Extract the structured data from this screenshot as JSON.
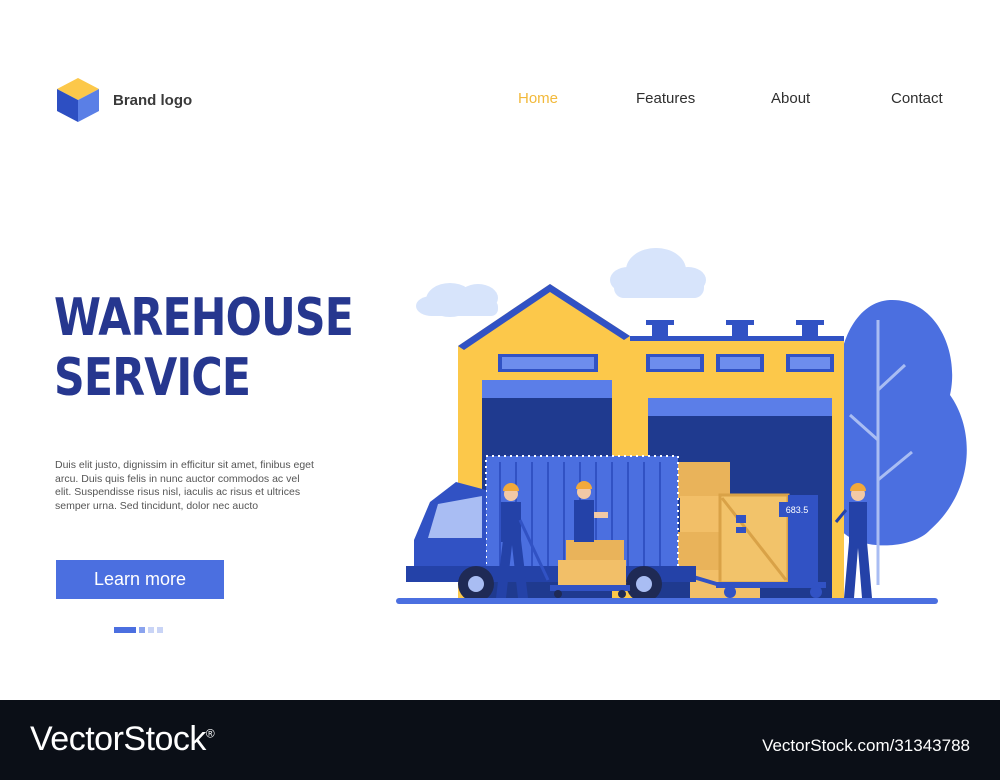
{
  "brand": {
    "label": "Brand logo",
    "icon": "cube-icon"
  },
  "nav": {
    "items": [
      {
        "label": "Home",
        "active": true
      },
      {
        "label": "Features",
        "active": false
      },
      {
        "label": "About",
        "active": false
      },
      {
        "label": "Contact",
        "active": false
      }
    ]
  },
  "hero": {
    "title_line1": "WAREHOUSE",
    "title_line2": "SERVICE",
    "body": "Duis elit justo, dignissim in efficitur sit amet, finibus eget arcu. Duis quis felis in nunc auctor commodos ac vel elit. Suspendisse risus nisl, iaculis ac risus et ultrices semper urna. Sed tincidunt, dolor nec aucto",
    "cta_label": "Learn more"
  },
  "carousel": {
    "slides": 4,
    "active_index": 0
  },
  "illustration": {
    "scale_reading": "683.5"
  },
  "watermark": {
    "left": "VectorStock",
    "reg": "®",
    "right": "VectorStock.com/31343788"
  },
  "colors": {
    "accent_blue": "#4b6fe0",
    "title_navy": "#26378f",
    "nav_active": "#f2b93b",
    "building_yellow": "#fcc84a"
  }
}
